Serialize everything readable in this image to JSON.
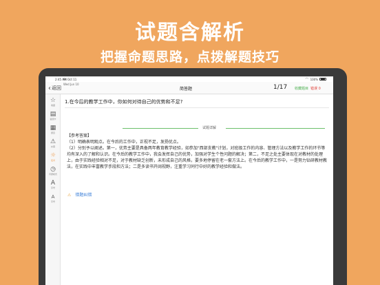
{
  "promo": {
    "title": "试题含解析",
    "subtitle": "把握命题思路，点拨解题技巧"
  },
  "status_bar": {
    "time": "2:45 AM",
    "date": "Fri Oct 11",
    "battery": "100%"
  },
  "nav": {
    "back_label": "返回",
    "back_date": "Wed Jun 10",
    "title": "简答题",
    "progress": "1/17",
    "collect": "收藏题目",
    "wrong": "错误 0"
  },
  "sidebar": {
    "items": [
      {
        "icon": "star-icon",
        "glyph": "☆",
        "label": "收藏"
      },
      {
        "icon": "answer-icon",
        "glyph": "▤",
        "label": "答题卡"
      },
      {
        "icon": "grid-icon",
        "glyph": "▦",
        "label": "题目"
      },
      {
        "icon": "warning-icon",
        "glyph": "⚠",
        "label": "纠错"
      },
      {
        "icon": "sun-icon",
        "glyph": "☼",
        "label": "夜间",
        "active": true
      },
      {
        "icon": "clock-icon",
        "glyph": "◷",
        "label": "背题模式"
      },
      {
        "icon": "font-large-icon",
        "glyph": "A",
        "label": "字号"
      },
      {
        "icon": "font-small-icon",
        "glyph": "A",
        "label": "字号"
      }
    ]
  },
  "content": {
    "question": "1.在今后的教学工作中，你如何对待自己的优势和不足?",
    "detail_label": "试题详解",
    "answer_head": "【参考答案】",
    "answer_p1": "（1）明确表明观点。在今后的工作中，正视不足，发扬优点。",
    "answer_p2": "（2）分别予以阐述。第一，优势主要是具备两年教育教学经验，如参加\"西部支教\"计划，对班级工作的内容、管理方法以及教学工作的环节等均有深入的了解和认识。在今后的教学工作中，我会发挥自己的优势，加强对学生个性问题的解决；第二，不足之处主要体现在对教材的处理上，由于实践经验相对不足，对于教材缺乏创新，未形成自己的风格，要多地停留在老一套方法上。在今后的教学工作中，一是努力钻研教材教法，在实践中丰富教学手段和方法；二是多读书开阔视野，注重学习同行中好的教学经验和做法。",
    "report_label": "错题纠错"
  },
  "colors": {
    "background": "#f0a65e",
    "accent_green": "#4caf50",
    "accent_red": "#e0443c",
    "link_blue": "#3b7fd8"
  }
}
